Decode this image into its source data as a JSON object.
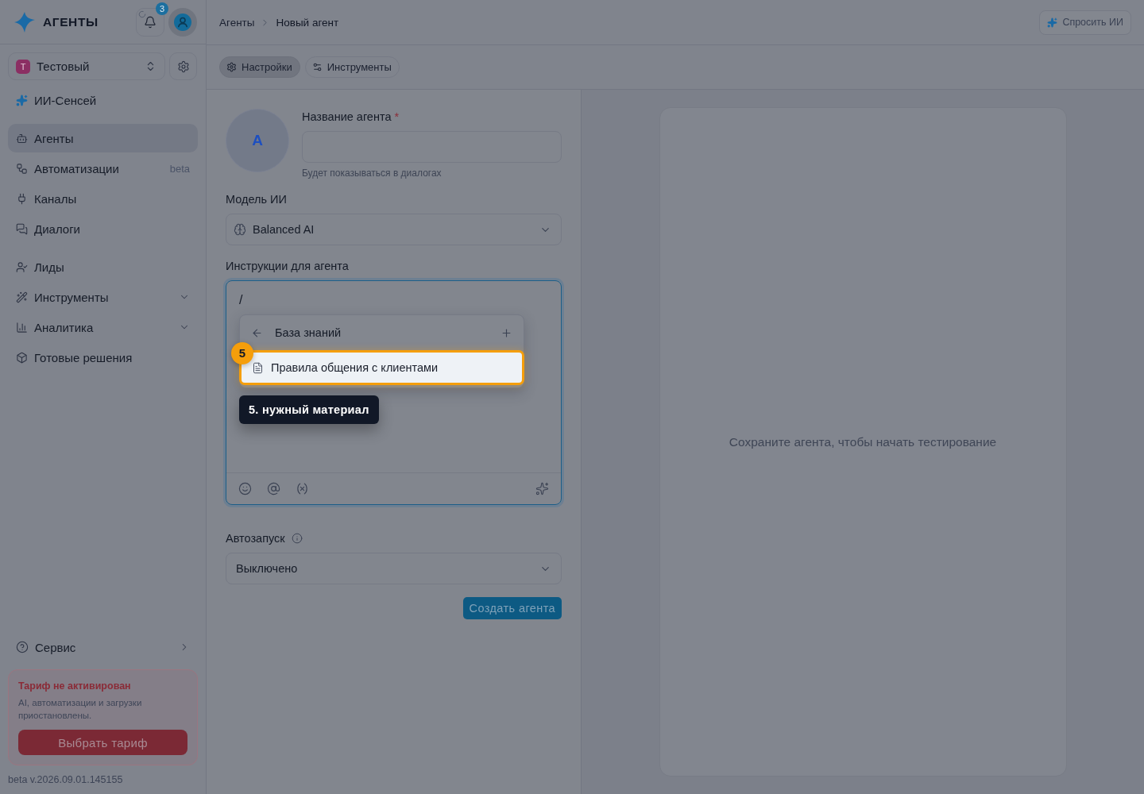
{
  "sidebar": {
    "brand": "АГЕНТЫ",
    "notifications": {
      "count": "3",
      "loading": true
    },
    "workspace": {
      "initial": "Т",
      "name": "Тестовый"
    },
    "sensei": {
      "label": "ИИ-Сенсей"
    },
    "nav_groups": [
      {
        "items": [
          {
            "label": "Агенты",
            "selected": true
          },
          {
            "label": "Автоматизации",
            "badge": "beta",
            "selected": false
          },
          {
            "label": "Каналы",
            "selected": false
          },
          {
            "label": "Диалоги",
            "selected": false
          }
        ]
      },
      {
        "items": [
          {
            "label": "Лиды",
            "selected": false
          },
          {
            "label": "Инструменты",
            "selected": false,
            "expanded": false
          },
          {
            "label": "Аналитика",
            "selected": false,
            "expanded": false
          },
          {
            "label": "Готовые решения",
            "selected": false
          }
        ]
      }
    ],
    "service": {
      "label": "Сервис"
    },
    "plan_card": {
      "title": "Тариф не активирован",
      "text": "AI, автоматизации и загрузки приостановлены.",
      "button": "Выбрать тариф"
    },
    "version": "beta v.2026.09.01.145155"
  },
  "header": {
    "breadcrumbs": [
      "Агенты",
      "Новый агент"
    ],
    "ask_ai": "Спросить ИИ"
  },
  "tabs": [
    {
      "label": "Настройки",
      "selected": true
    },
    {
      "label": "Инструменты",
      "selected": false
    }
  ],
  "form": {
    "avatar_initial": "A",
    "name_field": {
      "label": "Название агента",
      "required_mark": "*",
      "hint": "Будет показываться в диалогах"
    },
    "model": {
      "label": "Модель ИИ",
      "value": "Balanced AI"
    },
    "instructions": {
      "label": "Инструкции для агента",
      "value": "/",
      "menu": {
        "title": "База знаний",
        "items": [
          {
            "label": "Правила общения с клиентами",
            "highlighted": true
          }
        ]
      }
    },
    "autostart": {
      "label": "Автозапуск",
      "value": "Выключено"
    },
    "submit": "Создать агента"
  },
  "tour": {
    "step": "5",
    "tooltip": "5. нужный материал"
  },
  "preview": {
    "message": "Сохраните агента, чтобы начать тестирование"
  }
}
